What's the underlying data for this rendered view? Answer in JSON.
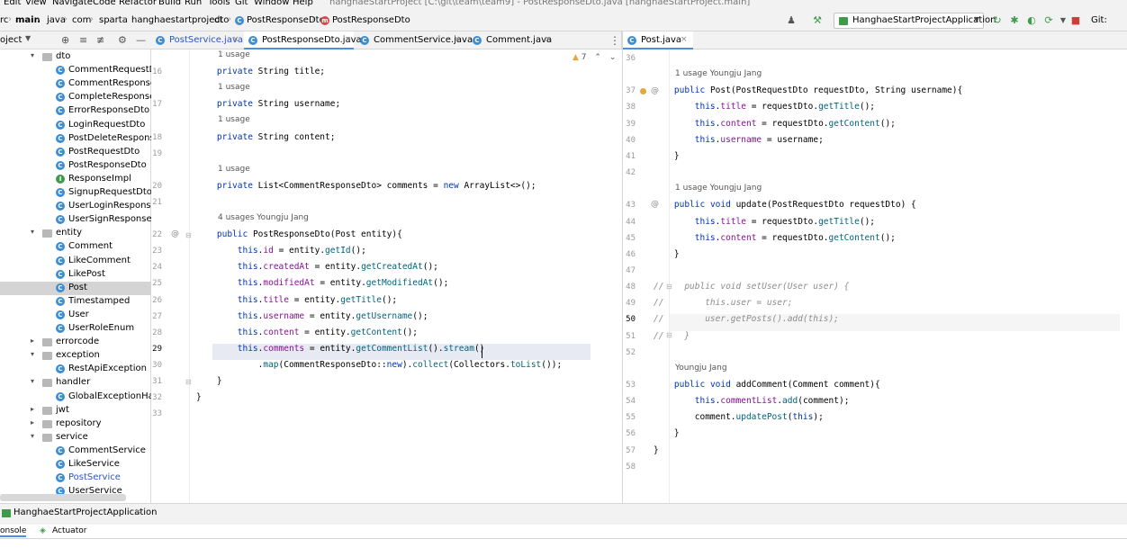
{
  "menu": [
    "Edit",
    "View",
    "Navigate",
    "Code",
    "Refactor",
    "Build",
    "Run",
    "Tools",
    "Git",
    "Window",
    "Help"
  ],
  "window_title": "hanghaeStartProject [C:\\git\\team\\team9] - PostResponseDto.java [hanghaeStartProject.main]",
  "breadcrumbs": [
    "rc",
    "main",
    "java",
    "com",
    "sparta",
    "hanghaestartproject",
    "dto",
    "PostResponseDto",
    "PostResponseDto"
  ],
  "run_config": "HanghaeStartProjectApplication",
  "git_label": "Git:",
  "project_panel": {
    "title": "oject",
    "tree": [
      {
        "label": "dto",
        "kind": "folder",
        "open": true,
        "depth": 1
      },
      {
        "label": "CommentRequestDto",
        "kind": "class",
        "depth": 2
      },
      {
        "label": "CommentResponseDto",
        "kind": "class",
        "depth": 2
      },
      {
        "label": "CompleteResponseDto",
        "kind": "class",
        "depth": 2
      },
      {
        "label": "ErrorResponseDto",
        "kind": "class",
        "depth": 2
      },
      {
        "label": "LoginRequestDto",
        "kind": "class",
        "depth": 2
      },
      {
        "label": "PostDeleteResponseDto",
        "kind": "class",
        "depth": 2
      },
      {
        "label": "PostRequestDto",
        "kind": "class",
        "depth": 2
      },
      {
        "label": "PostResponseDto",
        "kind": "class",
        "depth": 2
      },
      {
        "label": "ResponseImpl",
        "kind": "interface",
        "depth": 2
      },
      {
        "label": "SignupRequestDto",
        "kind": "class",
        "depth": 2
      },
      {
        "label": "UserLoginResponseDto",
        "kind": "class",
        "depth": 2
      },
      {
        "label": "UserSignResponseDto",
        "kind": "class",
        "depth": 2
      },
      {
        "label": "entity",
        "kind": "folder",
        "open": true,
        "depth": 1
      },
      {
        "label": "Comment",
        "kind": "class",
        "depth": 2
      },
      {
        "label": "LikeComment",
        "kind": "class",
        "depth": 2
      },
      {
        "label": "LikePost",
        "kind": "class",
        "depth": 2
      },
      {
        "label": "Post",
        "kind": "class",
        "depth": 2,
        "selected": true
      },
      {
        "label": "Timestamped",
        "kind": "class",
        "depth": 2
      },
      {
        "label": "User",
        "kind": "class",
        "depth": 2
      },
      {
        "label": "UserRoleEnum",
        "kind": "class",
        "depth": 2
      },
      {
        "label": "errorcode",
        "kind": "folder",
        "open": false,
        "depth": 1
      },
      {
        "label": "exception",
        "kind": "folder",
        "open": true,
        "depth": 1
      },
      {
        "label": "RestApiException",
        "kind": "class",
        "depth": 2
      },
      {
        "label": "handler",
        "kind": "folder",
        "open": true,
        "depth": 1
      },
      {
        "label": "GlobalExceptionHandler",
        "kind": "class",
        "depth": 2
      },
      {
        "label": "jwt",
        "kind": "folder",
        "open": false,
        "depth": 1
      },
      {
        "label": "repository",
        "kind": "folder",
        "open": false,
        "depth": 1
      },
      {
        "label": "service",
        "kind": "folder",
        "open": true,
        "depth": 1
      },
      {
        "label": "CommentService",
        "kind": "class",
        "depth": 2
      },
      {
        "label": "LikeService",
        "kind": "class",
        "depth": 2
      },
      {
        "label": "PostService",
        "kind": "class",
        "depth": 2,
        "blue": true
      },
      {
        "label": "UserService",
        "kind": "class",
        "depth": 2
      }
    ]
  },
  "tabs_left": [
    {
      "label": "PostService.java",
      "active": false,
      "blue": true
    },
    {
      "label": "PostResponseDto.java",
      "active": true
    },
    {
      "label": "CommentService.java",
      "active": false
    },
    {
      "label": "Comment.java",
      "active": false
    }
  ],
  "tabs_right": [
    {
      "label": "Post.java",
      "active": true
    }
  ],
  "left_warning": "7",
  "left_code": [
    {
      "n": "",
      "hint": "1 usage"
    },
    {
      "n": "16",
      "code": "    private String title;"
    },
    {
      "n": "",
      "hint": "1 usage"
    },
    {
      "n": "17",
      "code": "    private String username;"
    },
    {
      "n": "",
      "hint": "1 usage"
    },
    {
      "n": "18",
      "code": "    private String content;"
    },
    {
      "n": "19",
      "code": ""
    },
    {
      "n": "",
      "hint": "1 usage"
    },
    {
      "n": "20",
      "code": "    private List<CommentResponseDto> comments = new ArrayList<>();"
    },
    {
      "n": "21",
      "code": ""
    },
    {
      "n": "",
      "hint": "4 usages   Youngju Jang"
    },
    {
      "n": "22",
      "code": "    public PostResponseDto(Post entity){"
    },
    {
      "n": "23",
      "code": "        this.id = entity.getId();"
    },
    {
      "n": "24",
      "code": "        this.createdAt = entity.getCreatedAt();"
    },
    {
      "n": "25",
      "code": "        this.modifiedAt = entity.getModifiedAt();"
    },
    {
      "n": "26",
      "code": "        this.title = entity.getTitle();"
    },
    {
      "n": "27",
      "code": "        this.username = entity.getUsername();"
    },
    {
      "n": "28",
      "code": "        this.content = entity.getContent();"
    },
    {
      "n": "29",
      "code": "        this.comments = entity.getCommentList().stream()"
    },
    {
      "n": "30",
      "code": "            .map(CommentResponseDto::new).collect(Collectors.toList());"
    },
    {
      "n": "31",
      "code": "    }"
    },
    {
      "n": "32",
      "code": "}"
    },
    {
      "n": "33",
      "code": ""
    }
  ],
  "right_code": [
    {
      "n": "36",
      "code": ""
    },
    {
      "n": "",
      "hint": "1 usage   Youngju Jang"
    },
    {
      "n": "37",
      "code": "    public Post(PostRequestDto requestDto, String username){"
    },
    {
      "n": "38",
      "code": "        this.title = requestDto.getTitle();"
    },
    {
      "n": "39",
      "code": "        this.content = requestDto.getContent();"
    },
    {
      "n": "40",
      "code": "        this.username = username;"
    },
    {
      "n": "41",
      "code": "    }"
    },
    {
      "n": "42",
      "code": ""
    },
    {
      "n": "",
      "hint": "1 usage   Youngju Jang"
    },
    {
      "n": "43",
      "code": "    public void update(PostRequestDto requestDto) {"
    },
    {
      "n": "44",
      "code": "        this.title = requestDto.getTitle();"
    },
    {
      "n": "45",
      "code": "        this.content = requestDto.getContent();"
    },
    {
      "n": "46",
      "code": "    }"
    },
    {
      "n": "47",
      "code": ""
    },
    {
      "n": "48",
      "code": "//    public void setUser(User user) {"
    },
    {
      "n": "49",
      "code": "//        this.user = user;"
    },
    {
      "n": "50",
      "code": "//        user.getPosts().add(this);"
    },
    {
      "n": "51",
      "code": "//    }"
    },
    {
      "n": "52",
      "code": ""
    },
    {
      "n": "",
      "hint": "  Youngju Jang"
    },
    {
      "n": "53",
      "code": "    public void addComment(Comment comment){"
    },
    {
      "n": "54",
      "code": "        this.commentList.add(comment);"
    },
    {
      "n": "55",
      "code": "        comment.updatePost(this);"
    },
    {
      "n": "56",
      "code": "    }"
    },
    {
      "n": "57",
      "code": "}"
    },
    {
      "n": "58",
      "code": ""
    }
  ],
  "bottom_tab": "HanghaeStartProjectApplication",
  "console_tabs": [
    "onsole",
    "Actuator"
  ]
}
